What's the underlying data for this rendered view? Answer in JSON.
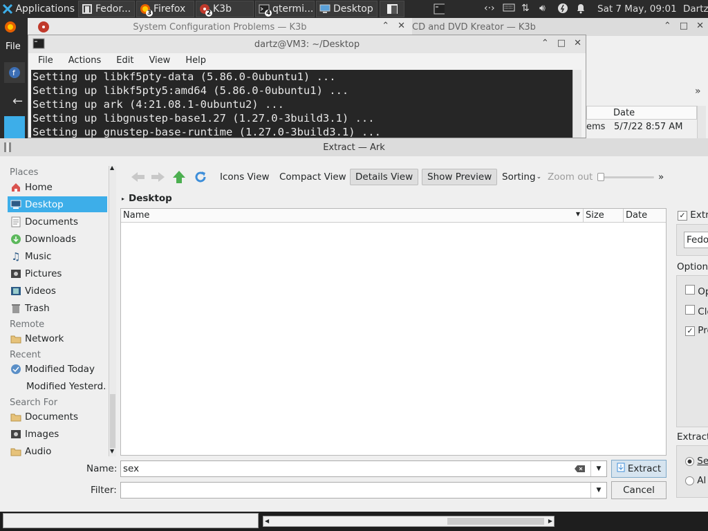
{
  "panel": {
    "applications": "Applications",
    "tasks": [
      {
        "label": "Fedor..."
      },
      {
        "label": "Firefox",
        "badge": "3"
      },
      {
        "label": "K3b",
        "badge": "2"
      },
      {
        "label": "qtermi...",
        "badge": "4"
      },
      {
        "label": "Desktop"
      }
    ],
    "clock": "Sat  7 May, 09:01",
    "user": "Dartz"
  },
  "k3b": {
    "title_left": "System Configuration Problems — K3b",
    "title_right": "CD and DVD Kreator — K3b",
    "menu_file": "File",
    "col_date": "Date",
    "row_text": "ems",
    "row_date": "5/7/22 8:57 AM",
    "more": "»"
  },
  "terminal": {
    "title": "dartz@VM3: ~/Desktop",
    "menu": [
      "File",
      "Actions",
      "Edit",
      "View",
      "Help"
    ],
    "lines": [
      "Setting up libkf5pty-data (5.86.0-0ubuntu1) ...",
      "Setting up libkf5pty5:amd64 (5.86.0-0ubuntu1) ...",
      "Setting up ark (4:21.08.1-0ubuntu2) ...",
      "Setting up libgnustep-base1.27 (1.27.0-3build3.1) ...",
      "Setting up gnustep-base-runtime (1.27.0-3build3.1) ..."
    ]
  },
  "ark": {
    "title": "Extract — Ark",
    "places": {
      "sec_places": "Places",
      "home": "Home",
      "desktop": "Desktop",
      "documents": "Documents",
      "downloads": "Downloads",
      "music": "Music",
      "pictures": "Pictures",
      "videos": "Videos",
      "trash": "Trash",
      "sec_remote": "Remote",
      "network": "Network",
      "sec_recent": "Recent",
      "modified_today": "Modified Today",
      "modified_yesterday": "Modified Yesterd...",
      "sec_search": "Search For",
      "s_documents": "Documents",
      "s_images": "Images",
      "s_audio": "Audio"
    },
    "toolbar": {
      "icons_view": "Icons View",
      "compact_view": "Compact View",
      "details_view": "Details View",
      "show_preview": "Show Preview",
      "sorting": "Sorting",
      "zoom_out": "Zoom out",
      "more": "»"
    },
    "breadcrumb": "Desktop",
    "columns": {
      "name": "Name",
      "size": "Size",
      "date": "Date"
    },
    "right": {
      "extract_to": "Extr",
      "folder_value": "Fedor",
      "options": "Options",
      "opt1": "Op",
      "opt2": "Clo",
      "opt3": "Pre",
      "extract_hdr": "Extract",
      "radio1": "Se",
      "radio2": "Al"
    },
    "name_label": "Name:",
    "name_value": "sex",
    "filter_label": "Filter:",
    "filter_value": "",
    "extract_button": "Extract",
    "cancel_button": "Cancel"
  },
  "colors": {
    "accent": "#3daee9",
    "panel": "#2b2b2b",
    "terminal_bg": "#262626"
  }
}
